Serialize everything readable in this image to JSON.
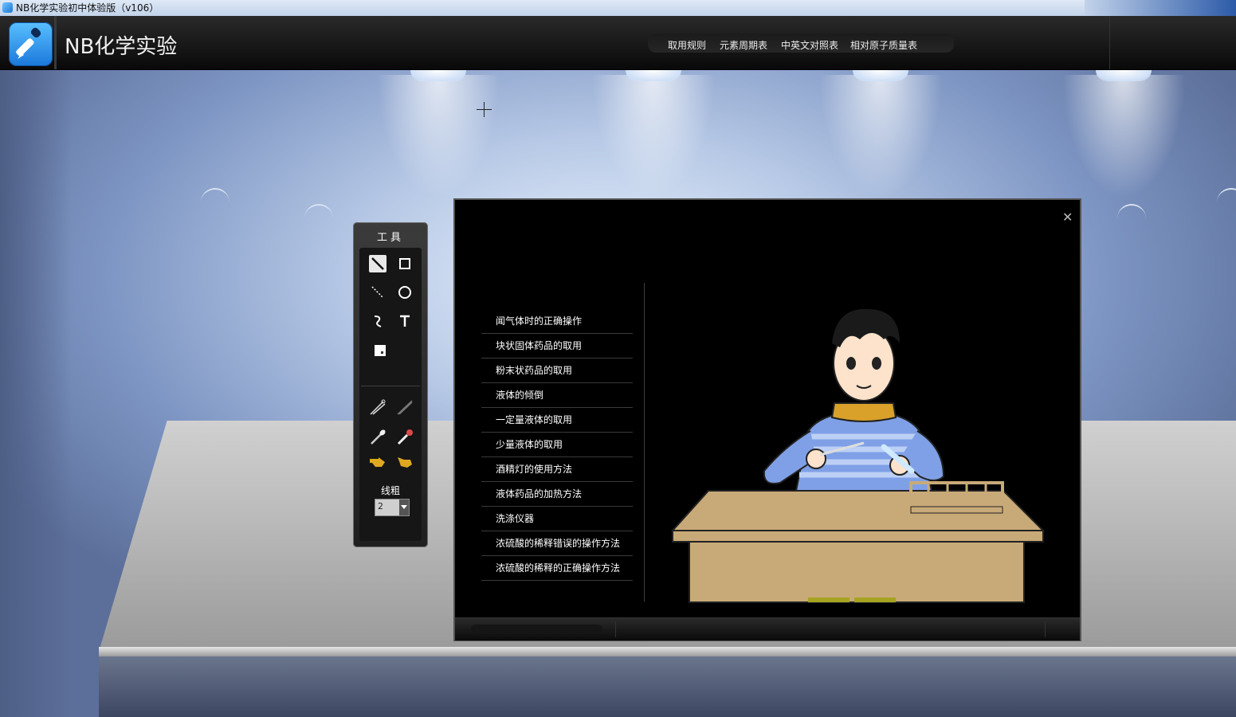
{
  "window": {
    "title": "NB化学实验初中体验版（v106）"
  },
  "header": {
    "brand": "NB化学实验",
    "nav": [
      "取用规则",
      "元素周期表",
      "中英文对照表",
      "相对原子质量表"
    ]
  },
  "tools": {
    "title": "工具",
    "line_width_label": "线粗",
    "line_width_value": "2",
    "icons": [
      "line-icon",
      "rectangle-icon",
      "dashed-line-icon",
      "circle-icon",
      "curve-icon",
      "text-icon",
      "eraser-icon",
      "tongs-icon",
      "tweezers-icon",
      "spoon-icon",
      "dropper-icon",
      "hand-pointer-icon",
      "hand-grab-icon"
    ]
  },
  "panel": {
    "menu": [
      "闻气体时的正确操作",
      "块状固体药品的取用",
      "粉末状药品的取用",
      "液体的倾倒",
      "一定量液体的取用",
      "少量液体的取用",
      "酒精灯的使用方法",
      "液体药品的加热方法",
      "洗涤仪器",
      "浓硫酸的稀释错误的操作方法",
      "浓硫酸的稀释的正确操作方法"
    ],
    "close_icon": "close-icon"
  },
  "colors": {
    "header": "#0f0f0f",
    "accent": "#1a77db",
    "table": "#c8aa78"
  }
}
